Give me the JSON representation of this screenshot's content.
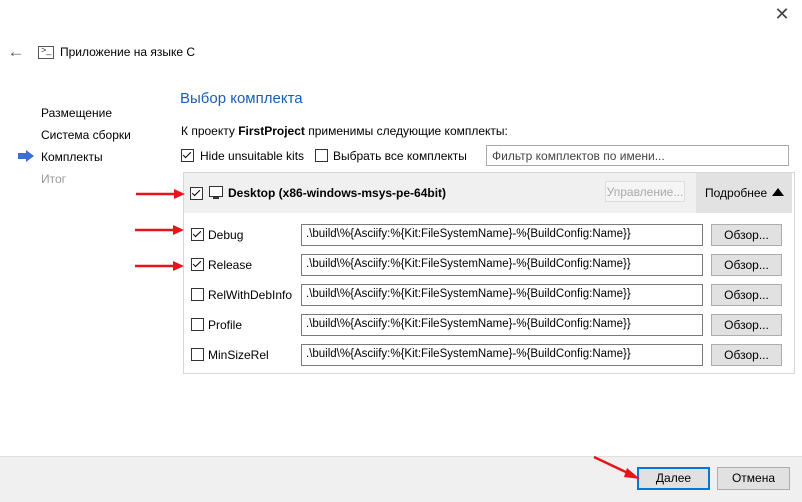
{
  "window": {
    "title": "Приложение на языке C"
  },
  "steps": [
    {
      "label": "Размещение"
    },
    {
      "label": "Система сборки"
    },
    {
      "label": "Комплекты"
    },
    {
      "label": "Итог"
    }
  ],
  "page": {
    "title": "Выбор комплекта",
    "intro_prefix": "К проекту ",
    "project_name": "FirstProject",
    "intro_suffix": " применимы следующие комплекты:"
  },
  "options": {
    "hide_unsuitable": {
      "label": "Hide unsuitable kits",
      "checked": true
    },
    "select_all": {
      "label": "Выбрать все комплекты",
      "checked": false
    },
    "filter": {
      "placeholder": "Фильтр комплектов по имени..."
    }
  },
  "kit": {
    "name": "Desktop (x86-windows-msys-pe-64bit)",
    "checked": true,
    "manage_label": "Управление...",
    "details_label": "Подробнее"
  },
  "build_configs": [
    {
      "name": "Debug",
      "checked": true,
      "path": ".\\build\\%{Asciify:%{Kit:FileSystemName}-%{BuildConfig:Name}}",
      "browse": "Обзор..."
    },
    {
      "name": "Release",
      "checked": true,
      "path": ".\\build\\%{Asciify:%{Kit:FileSystemName}-%{BuildConfig:Name}}",
      "browse": "Обзор..."
    },
    {
      "name": "RelWithDebInfo",
      "checked": false,
      "path": ".\\build\\%{Asciify:%{Kit:FileSystemName}-%{BuildConfig:Name}}",
      "browse": "Обзор..."
    },
    {
      "name": "Profile",
      "checked": false,
      "path": ".\\build\\%{Asciify:%{Kit:FileSystemName}-%{BuildConfig:Name}}",
      "browse": "Обзор..."
    },
    {
      "name": "MinSizeRel",
      "checked": false,
      "path": ".\\build\\%{Asciify:%{Kit:FileSystemName}-%{BuildConfig:Name}}",
      "browse": "Обзор..."
    }
  ],
  "footer": {
    "next_label": "Далее",
    "cancel_label": "Отмена"
  },
  "colors": {
    "accent": "#0078d7",
    "title": "#1a5fb4",
    "annotation_arrow": "#e8141c"
  }
}
